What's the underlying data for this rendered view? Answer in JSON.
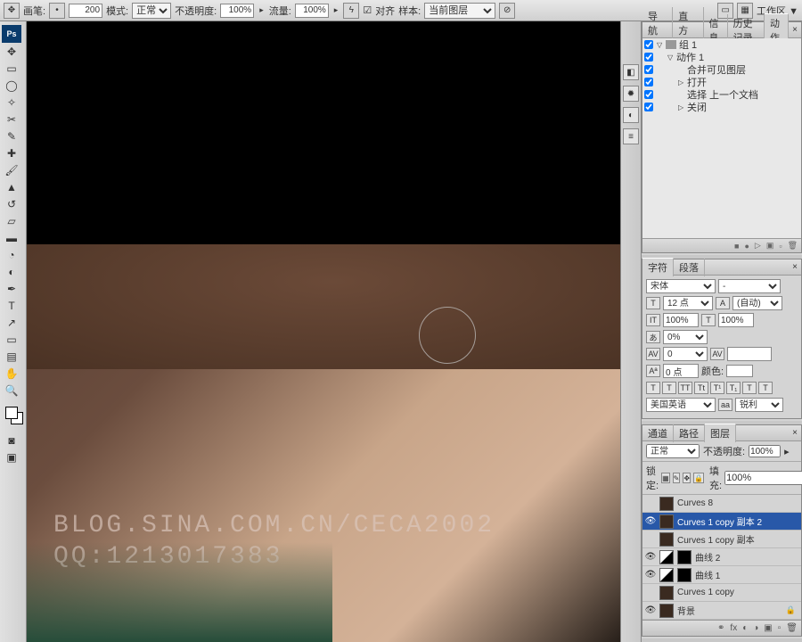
{
  "topbar": {
    "brush_label": "画笔:",
    "brush_size": "200",
    "mode_label": "模式:",
    "mode_value": "正常",
    "opacity_label": "不透明度:",
    "opacity_value": "100%",
    "flow_label": "流量:",
    "flow_value": "100%",
    "align": "对齐",
    "sample_label": "样本:",
    "sample_value": "当前图层",
    "workspace": "工作区 ▼"
  },
  "history": {
    "tabs": [
      "导航器",
      "直方图",
      "信息",
      "历史记录",
      "动作"
    ],
    "items": [
      {
        "level": 0,
        "tri": "▽",
        "folder": true,
        "label": "组 1"
      },
      {
        "level": 1,
        "tri": "▽",
        "label": "动作 1"
      },
      {
        "level": 2,
        "tri": "",
        "label": "合并可见图层"
      },
      {
        "level": 2,
        "tri": "▷",
        "label": "打开"
      },
      {
        "level": 2,
        "tri": "",
        "label": "选择 上一个文档"
      },
      {
        "level": 2,
        "tri": "▷",
        "label": "关闭"
      }
    ]
  },
  "char": {
    "tabs": [
      "字符",
      "段落"
    ],
    "font": "宋体",
    "style": "-",
    "size": "12 点",
    "leading": "(自动)",
    "tracking": "100%",
    "scale": "100%",
    "baseline": "0%",
    "shift": "0 点",
    "color_label": "颜色:",
    "lang": "美国英语",
    "aa": "锐利"
  },
  "layers": {
    "tabs": [
      "通道",
      "路径",
      "图层"
    ],
    "blend": "正常",
    "opacity_label": "不透明度:",
    "opacity": "100%",
    "lock_label": "锁定:",
    "fill_label": "填充:",
    "fill": "100%",
    "list": [
      {
        "eye": "",
        "type": "adj",
        "name": "Curves 8"
      },
      {
        "eye": "👁",
        "type": "adj",
        "name": "Curves 1 copy 副本 2",
        "sel": true
      },
      {
        "eye": "",
        "type": "adj",
        "name": "Curves 1 copy 副本"
      },
      {
        "eye": "👁",
        "type": "curve",
        "name": "曲线 2"
      },
      {
        "eye": "👁",
        "type": "curve",
        "name": "曲线 1"
      },
      {
        "eye": "",
        "type": "adj",
        "name": "Curves 1 copy"
      },
      {
        "eye": "👁",
        "type": "img",
        "name": "背景",
        "lock": true
      }
    ]
  },
  "watermark": {
    "l1": "BLOG.SINA.COM.CN/CECA2002",
    "l2": "QQ:1213017383"
  }
}
